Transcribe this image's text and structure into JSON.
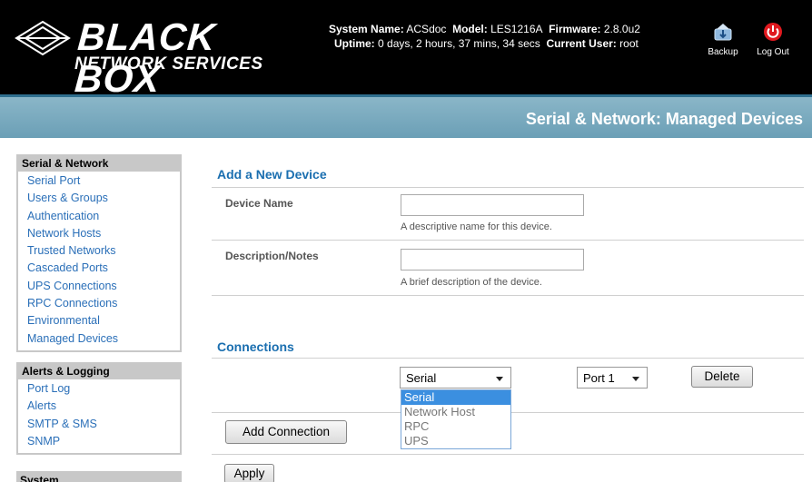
{
  "header": {
    "logo_main": "BLACK BOX",
    "logo_sub": "NETWORK SERVICES",
    "system_name_label": "System Name:",
    "system_name": "ACSdoc",
    "model_label": "Model:",
    "model": "LES1216A",
    "firmware_label": "Firmware:",
    "firmware": "2.8.0u2",
    "uptime_label": "Uptime:",
    "uptime": "0 days, 2 hours, 37 mins, 34 secs",
    "current_user_label": "Current User:",
    "current_user": "root",
    "backup_label": "Backup",
    "logout_label": "Log Out"
  },
  "title": "Serial & Network: Managed Devices",
  "sidebar": {
    "groups": [
      {
        "title": "Serial & Network",
        "items": [
          "Serial Port",
          "Users & Groups",
          "Authentication",
          "Network Hosts",
          "Trusted Networks",
          "Cascaded Ports",
          "UPS Connections",
          "RPC Connections",
          "Environmental",
          "Managed Devices"
        ]
      },
      {
        "title": "Alerts & Logging",
        "items": [
          "Port Log",
          "Alerts",
          "SMTP & SMS",
          "SNMP"
        ]
      },
      {
        "title": "System",
        "items": []
      }
    ]
  },
  "form": {
    "add_title": "Add a New Device",
    "device_name_label": "Device Name",
    "device_name_value": "",
    "device_name_hint": "A descriptive name for this device.",
    "description_label": "Description/Notes",
    "description_value": "",
    "description_hint": "A brief description of the device.",
    "connections_title": "Connections",
    "connection_type": "Serial",
    "connection_type_options": [
      "Serial",
      "Network Host",
      "RPC",
      "UPS"
    ],
    "port": "Port 1",
    "delete_label": "Delete",
    "add_connection_label": "Add Connection",
    "apply_label": "Apply"
  },
  "colors": {
    "header_bg": "#000000",
    "title_bar": "#7aaabf",
    "link": "#2a6fb8",
    "section_title": "#1b6fb0",
    "dropdown_highlight": "#3b8fe0"
  }
}
